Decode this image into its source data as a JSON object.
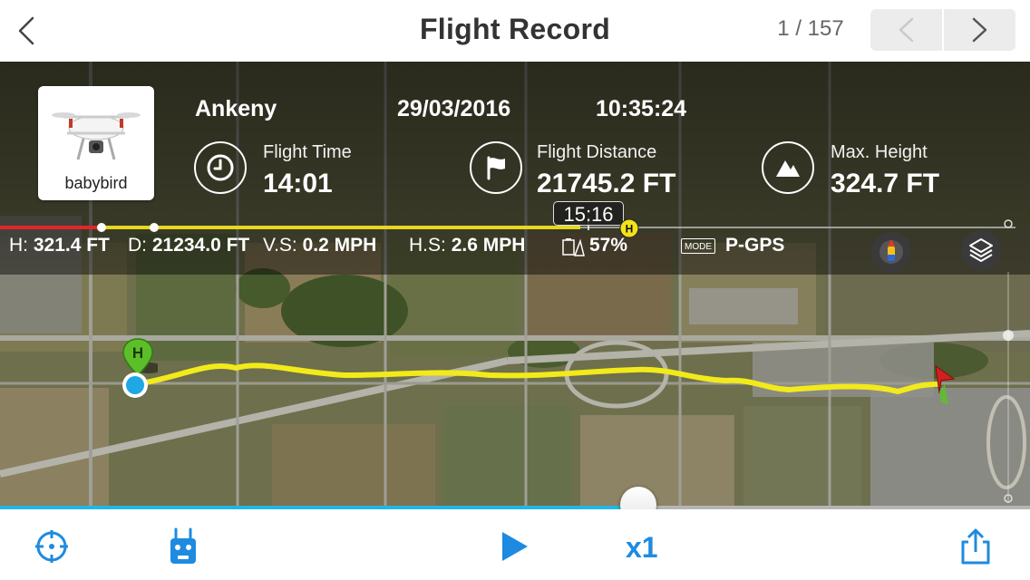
{
  "header": {
    "title": "Flight Record",
    "counter": "1 / 157"
  },
  "flight": {
    "aircraft_name": "babybird",
    "location": "Ankeny",
    "date": "29/03/2016",
    "time": "10:35:24",
    "stats": [
      {
        "label": "Flight Time",
        "value": "14:01",
        "icon": "clock-icon"
      },
      {
        "label": "Flight Distance",
        "value": "21745.2 FT",
        "icon": "flag-icon"
      },
      {
        "label": "Max. Height",
        "value": "324.7 FT",
        "icon": "mountain-icon"
      }
    ]
  },
  "timeline": {
    "current_time": "15:16",
    "home_marker": "H"
  },
  "telemetry": {
    "h_label": "H:",
    "h_value": "321.4 FT",
    "d_label": "D:",
    "d_value": "21234.0 FT",
    "vs_label": "V.S:",
    "vs_value": "0.2 MPH",
    "hs_label": "H.S:",
    "hs_value": "2.6 MPH",
    "battery": "57%",
    "mode_badge": "MODE",
    "mode": "P-GPS"
  },
  "map": {
    "home_label": "H",
    "path_color": "#f2ea1a",
    "home_color": "#5cbf2a",
    "aircraft_color": "#d3201f"
  },
  "playback": {
    "progress": 0.62,
    "speed": "x1",
    "accent": "#1e8be0"
  }
}
